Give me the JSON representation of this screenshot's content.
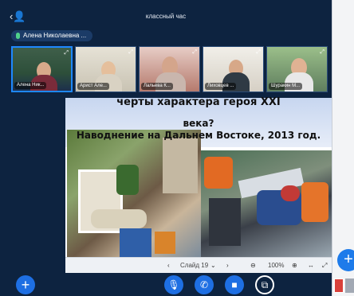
{
  "app": {
    "title": "классный час"
  },
  "presenter": {
    "name": "Алена Николаевна ..."
  },
  "participants": [
    {
      "label": "Алена Ник..."
    },
    {
      "label": "Арист Але..."
    },
    {
      "label": "Лальева К..."
    },
    {
      "label": "Лиховцев ..."
    },
    {
      "label": "Шуракин М..."
    }
  ],
  "slide": {
    "line1": "черты характера героя XXI",
    "line2": "века?",
    "line3": "Наводнение на Дальнем Востоке, 2013 год."
  },
  "slide_toolbar": {
    "slide_label": "Слайд 19",
    "zoom": "100%"
  },
  "icons": {
    "prev": "chevron-left",
    "next": "chevron-right",
    "zoom_out": "minus-circle",
    "zoom_in": "plus-circle",
    "fit": "arrows-horizontal",
    "fullscreen": "expand"
  },
  "colors": {
    "accent": "#1e6fe3",
    "background": "#0d2340"
  }
}
